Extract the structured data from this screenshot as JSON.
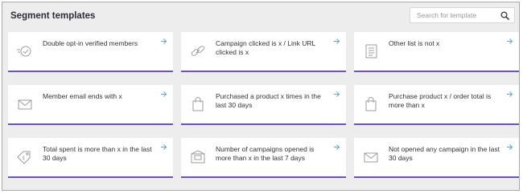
{
  "header": {
    "title": "Segment templates"
  },
  "search": {
    "placeholder": "Search for template",
    "value": ""
  },
  "colors": {
    "accent": "#6f4fc4",
    "arrow": "#5aa7d6",
    "icon": "#9e9e9e",
    "background": "#ededed",
    "card": "#ffffff"
  },
  "templates": [
    {
      "label": "Double opt-in verified members",
      "icon": "verified-check-icon"
    },
    {
      "label": "Campaign clicked is x / Link URL clicked is x",
      "icon": "link-icon"
    },
    {
      "label": "Other list is not x",
      "icon": "list-document-icon"
    },
    {
      "label": "Member email ends with x",
      "icon": "envelope-icon"
    },
    {
      "label": "Purchased a product x times in the last 30 days",
      "icon": "shopping-bag-icon"
    },
    {
      "label": "Purchase product x / order total is more than x",
      "icon": "shopping-bag-icon"
    },
    {
      "label": "Total spent is more than x in the last 30 days",
      "icon": "money-tag-icon"
    },
    {
      "label": "Number of campaigns opened is more than x in the last 7 days",
      "icon": "open-envelope-icon"
    },
    {
      "label": "Not opened any campaign in the last 30 days",
      "icon": "envelope-icon"
    }
  ]
}
